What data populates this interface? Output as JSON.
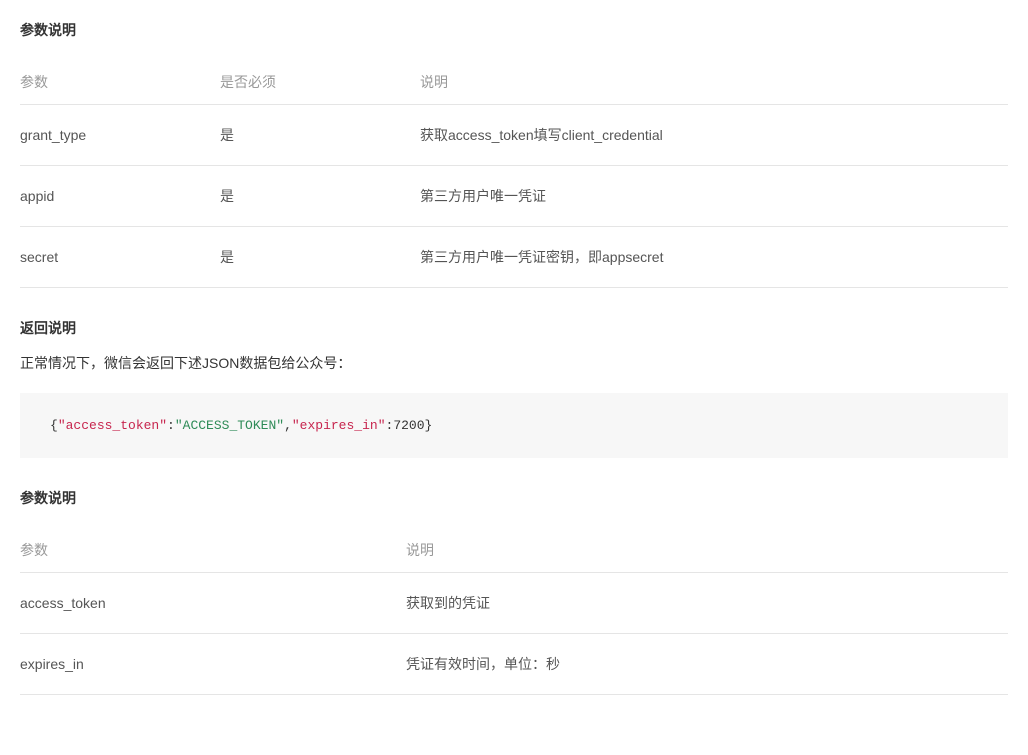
{
  "section1_title": "参数说明",
  "table1": {
    "headers": {
      "param": "参数",
      "required": "是否必须",
      "desc": "说明"
    },
    "rows": [
      {
        "param": "grant_type",
        "required": "是",
        "desc": "获取access_token填写client_credential"
      },
      {
        "param": "appid",
        "required": "是",
        "desc": "第三方用户唯一凭证"
      },
      {
        "param": "secret",
        "required": "是",
        "desc": "第三方用户唯一凭证密钥，即appsecret"
      }
    ]
  },
  "return_title": "返回说明",
  "return_desc": "正常情况下，微信会返回下述JSON数据包给公众号：",
  "code": {
    "key1": "\"access_token\"",
    "val1": "\"ACCESS_TOKEN\"",
    "key2": "\"expires_in\"",
    "val2": "7200"
  },
  "section2_title": "参数说明",
  "table2": {
    "headers": {
      "param": "参数",
      "desc": "说明"
    },
    "rows": [
      {
        "param": "access_token",
        "desc": "获取到的凭证"
      },
      {
        "param": "expires_in",
        "desc": "凭证有效时间，单位：秒"
      }
    ]
  }
}
